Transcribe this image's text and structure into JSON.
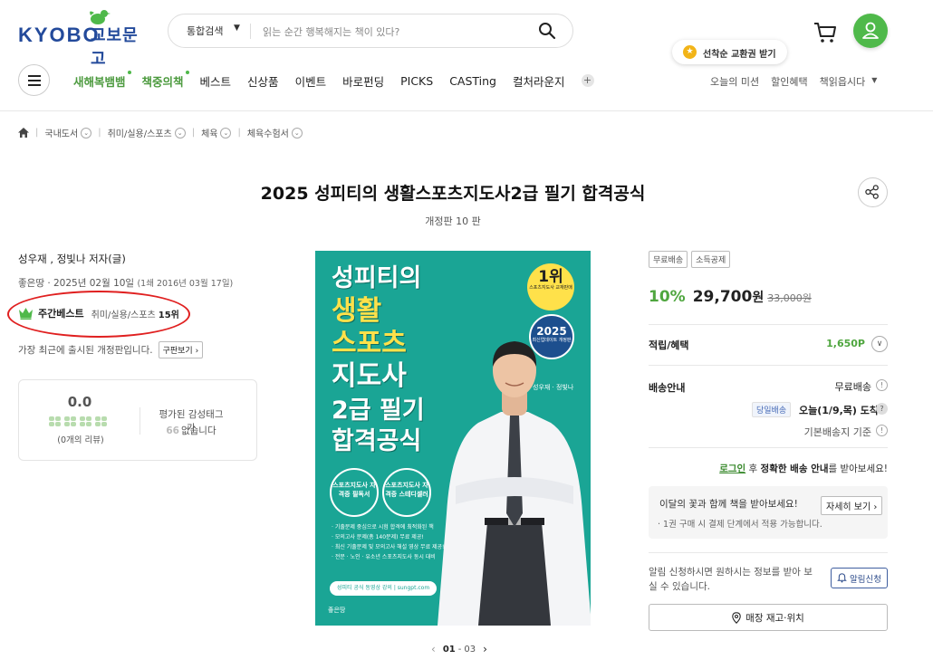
{
  "logo": {
    "en": "KYOBO",
    "ko": "교보문고"
  },
  "search": {
    "scope": "통합검색",
    "placeholder": "읽는 순간 행복해지는 책이 있다?"
  },
  "promo": {
    "text": "선착순 교환권 받기"
  },
  "nav": {
    "items": [
      "새해복뱀뱀",
      "책중의책",
      "베스트",
      "신상품",
      "이벤트",
      "바로펀딩",
      "PICKS",
      "CASTing",
      "컬처라운지"
    ],
    "plus": "+",
    "right": [
      "오늘의 미션",
      "할인혜택",
      "책읽읍시다"
    ]
  },
  "breadcrumb": [
    "국내도서",
    "취미/실용/스포츠",
    "체육",
    "체육수험서"
  ],
  "product": {
    "title": "2025 성피티의 생활스포츠지도사2급 필기 합격공식",
    "edition": "개정판 10 판"
  },
  "left": {
    "author": "성우재 , 정빛나 저자(글)",
    "publisher": "좋은땅 · 2025년 02월 10일",
    "publisher_small": "(1쇄 2016년 03월 17일)",
    "best_label": "주간베스트",
    "best_category": "취미/실용/스포츠",
    "best_rank": "15위",
    "revision_note": "가장 최근에 출시된 개정판입니다.",
    "prev_button": "구판보기 ›",
    "rating": {
      "score": "0.0",
      "count": "(0개의 리뷰)",
      "tag_label": "평가된 감성태그가",
      "tag_value": "없습니다",
      "quote": "66"
    }
  },
  "cover": {
    "title_lines": [
      "성피티의",
      "생활",
      "스포츠",
      "지도사",
      "2급 필기",
      "합격공식"
    ],
    "badge1_num": "1위",
    "badge1_sub": "스포츠지도사 교재판매",
    "badge2_num": "2025",
    "badge2_sub": "최신업데이트 개정판",
    "authors": "성우재 · 정빛나",
    "circle1": "스포츠지도사 자격증 필독서",
    "circle2": "스포츠지도사 자격증 스테디셀러",
    "bullets": [
      "· 기출문제 중심으로 시험 합격에 최적화된 책",
      "· 모의고사 문제(총 140문제) 무료 제공!",
      "· 최신 기출문제 및 모의고사 해설 영상 무료 제공!",
      "· 전문 · 노인 · 유소년 스포츠지도사 동시 대비"
    ],
    "url": "성피티 공식 동영상 강의 | sungpt.com",
    "publisher": "좋은땅"
  },
  "pager": {
    "current": "01",
    "total": "03",
    "sep": "-"
  },
  "right": {
    "badges": [
      "무료배송",
      "소득공제"
    ],
    "discount": "10%",
    "price": "29,700",
    "won": "원",
    "original": "33,000원",
    "points_label": "적립/혜택",
    "points_value": "1,650P",
    "shipping_label": "배송안내",
    "shipping_free": "무료배송",
    "sameday": "당일배송",
    "arrival": "오늘(1/9,목) 도착",
    "base_fee": "기본배송지 기준",
    "login_link": "로그인",
    "login_mid": " 후 ",
    "login_bold": "정확한 배송 안내",
    "login_tail": "를 받아보세요!",
    "gift_title": "이달의 꽃과 함께 책을 받아보세요!",
    "gift_button": "자세히 보기 ›",
    "gift_sub": "· 1권 구매 시 결제 단계에서 적용 가능합니다.",
    "notify_text": "알림 신청하시면 원하시는 정보를 받아 보실 수 있습니다.",
    "notify_button": "알림신청",
    "store_button": "매장 재고·위치"
  },
  "colors": {
    "brand_green": "#4fb94a",
    "brand_blue": "#234a9b",
    "cover_teal": "#1aa595",
    "highlight_red": "#e02020"
  }
}
